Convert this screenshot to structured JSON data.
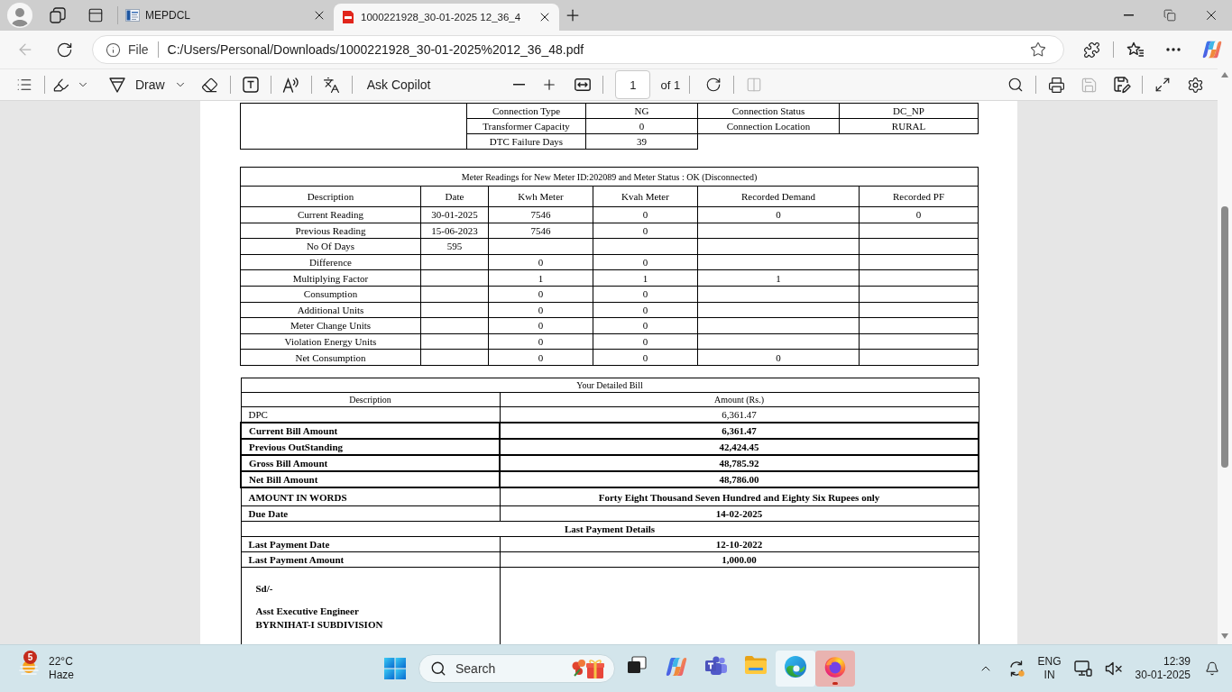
{
  "browser": {
    "tabs": [
      {
        "kind": "site",
        "title": "MEPDCL",
        "selected": false
      },
      {
        "kind": "pdf",
        "title": "1000221928_30-01-2025 12_36_4",
        "selected": true
      }
    ],
    "back": {
      "disabled": true
    },
    "address_bar": {
      "scheme": "File",
      "url": "C:/Users/Personal/Downloads/1000221928_30-01-2025%2012_36_48.pdf"
    }
  },
  "pdf_toolbar": {
    "draw_label": "Draw",
    "copilot_label": "Ask Copilot",
    "page": "1",
    "page_count": "of 1",
    "page_view_disabled": true,
    "save_disabled": true
  },
  "document": {
    "connection_table": {
      "rows": [
        [
          "Connection Type",
          "NG",
          "Connection Status",
          "DC_NP"
        ],
        [
          "Transformer Capacity",
          "0",
          "Connection Location",
          "RURAL"
        ],
        [
          "DTC Failure Days",
          "39"
        ]
      ]
    },
    "meter_readings": {
      "title": "Meter Readings for New Meter ID:202089 and Meter Status : OK (Disconnected)",
      "columns": [
        "Description",
        "Date",
        "Kwh Meter",
        "Kvah Meter",
        "Recorded Demand",
        "Recorded PF"
      ],
      "rows": [
        {
          "description": "Current Reading",
          "date": "30-01-2025",
          "kwh_meter": "7546",
          "kvah_meter": "0",
          "recorded_demand": "0",
          "recorded_pf": "0"
        },
        {
          "description": "Previous Reading",
          "date": "15-06-2023",
          "kwh_meter": "7546",
          "kvah_meter": "0"
        },
        {
          "description": "No Of Days",
          "date": "595"
        },
        {
          "description": "Difference",
          "kwh_meter": "0",
          "kvah_meter": "0"
        },
        {
          "description": "Multiplying Factor",
          "kwh_meter": "1",
          "kvah_meter": "1",
          "recorded_demand": "1"
        },
        {
          "description": "Consumption",
          "kwh_meter": "0",
          "kvah_meter": "0"
        },
        {
          "description": "Additional Units",
          "kwh_meter": "0",
          "kvah_meter": "0"
        },
        {
          "description": "Meter Change Units",
          "kwh_meter": "0",
          "kvah_meter": "0"
        },
        {
          "description": "Violation Energy Units",
          "kwh_meter": "0",
          "kvah_meter": "0"
        },
        {
          "description": "Net Consumption",
          "kwh_meter": "0",
          "kvah_meter": "0",
          "recorded_demand": "0"
        }
      ]
    },
    "detailed_bill": {
      "title": "Your Detailed Bill",
      "columns": [
        "Description",
        "Amount (Rs.)"
      ],
      "rows": [
        {
          "kind": "plain",
          "description": "DPC",
          "amount": "6,361.47"
        },
        {
          "kind": "total",
          "description": "Current Bill Amount",
          "amount": "6,361.47"
        },
        {
          "kind": "total",
          "description": "Previous OutStanding",
          "amount": "42,424.45"
        },
        {
          "kind": "total",
          "description": "Gross Bill Amount",
          "amount": "48,785.92"
        },
        {
          "kind": "total",
          "description": "Net Bill Amount",
          "amount": "48,786.00"
        },
        {
          "kind": "info",
          "description": "AMOUNT IN WORDS",
          "amount": "Forty Eight Thousand Seven Hundred and Eighty Six Rupees only"
        },
        {
          "kind": "info",
          "description": "Due Date",
          "amount": "14-02-2025"
        },
        {
          "kind": "section",
          "label": "Last Payment Details"
        },
        {
          "kind": "info",
          "description": "Last Payment Date",
          "amount": "12-10-2022"
        },
        {
          "kind": "info",
          "description": "Last Payment Amount",
          "amount": "1,000.00"
        }
      ],
      "signature": [
        "Sd/-",
        "Asst Executive Engineer",
        "BYRNIHAT-I SUBDIVISION"
      ]
    }
  },
  "taskbar": {
    "weather": {
      "alerts": "5",
      "temperature": "22°C",
      "condition": "Haze"
    },
    "search": {
      "label": "Search"
    },
    "apps": [
      {
        "kind": "task_view",
        "active": false,
        "flashing": false
      },
      {
        "kind": "copilot",
        "active": false,
        "flashing": false
      },
      {
        "kind": "teams",
        "active": false,
        "flashing": false
      },
      {
        "kind": "explorer",
        "active": false,
        "flashing": false
      },
      {
        "kind": "edge",
        "active": true,
        "flashing": false
      },
      {
        "kind": "firefox",
        "active": false,
        "flashing": true
      }
    ],
    "tray": {
      "language": "ENG",
      "region": "IN",
      "time": "12:39",
      "date": "30-01-2025"
    }
  }
}
